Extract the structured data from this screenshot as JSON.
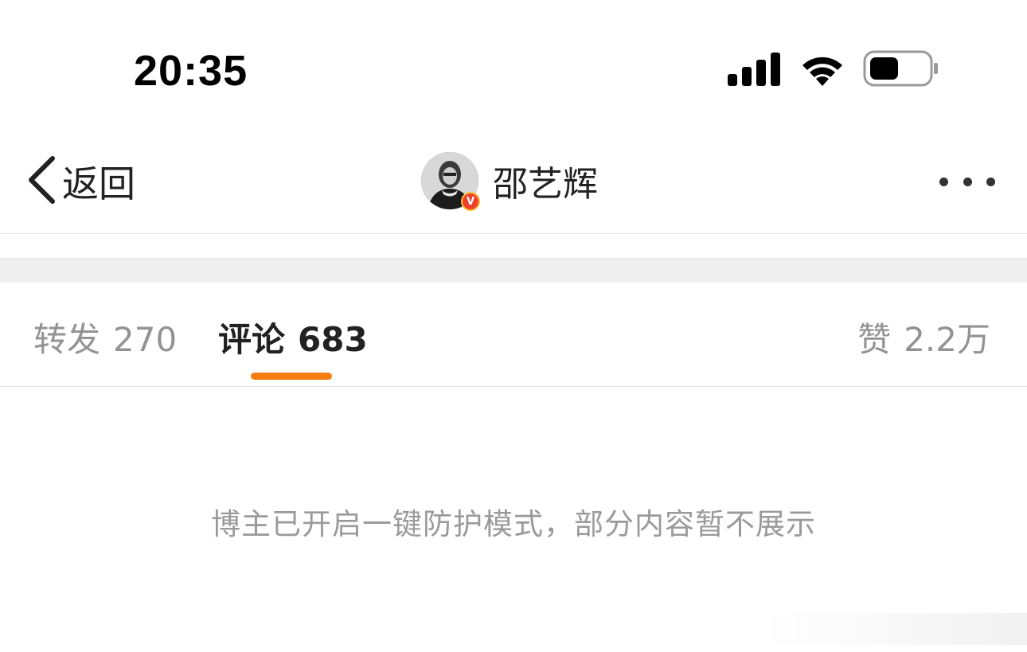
{
  "status_bar": {
    "time": "20:35",
    "icons": [
      "signal-icon",
      "wifi-icon",
      "battery-icon"
    ]
  },
  "nav": {
    "back_label": "返回",
    "profile_name": "邵艺辉",
    "verified_badge": "V",
    "more_icon": "more-dots-icon"
  },
  "tabs": [
    {
      "label": "转发",
      "count": "270",
      "active": false
    },
    {
      "label": "评论",
      "count": "683",
      "active": true
    },
    {
      "label": "赞",
      "count": "2.2万",
      "active": false
    }
  ],
  "notice": "博主已开启一键防护模式，部分内容暂不展示",
  "colors": {
    "accent_indicator": "#f57d12",
    "inactive_tab": "#939393",
    "active_tab": "#222222",
    "notice_text": "#9a9a9a",
    "spacer_gray": "#efefef",
    "verified_red": "#f0402b"
  }
}
